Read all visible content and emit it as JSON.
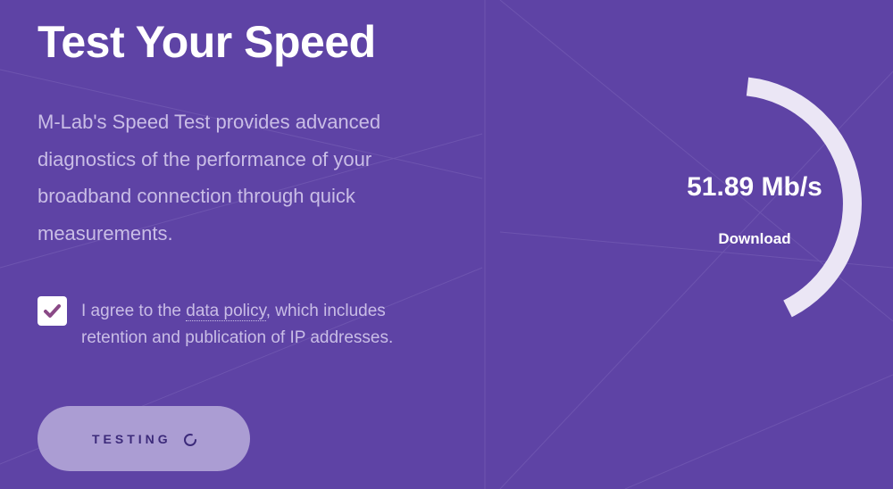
{
  "hero": {
    "title": "Test Your Speed",
    "description": "M-Lab's Speed Test provides advanced diagnostics of the performance of your broadband connection through quick measurements."
  },
  "agreement": {
    "checked": true,
    "text_before": "I agree to the ",
    "link_text": "data policy",
    "text_after": ", which includes retention and publication of IP addresses."
  },
  "button": {
    "label": "TESTING",
    "icon": "spinner-icon"
  },
  "gauge": {
    "value": "51.89 Mb/s",
    "label": "Download"
  },
  "colors": {
    "background": "#5e43a5",
    "button": "#ab9dd3",
    "gauge_arc": "#ebe6f5",
    "muted_text": "#c9bde6"
  }
}
